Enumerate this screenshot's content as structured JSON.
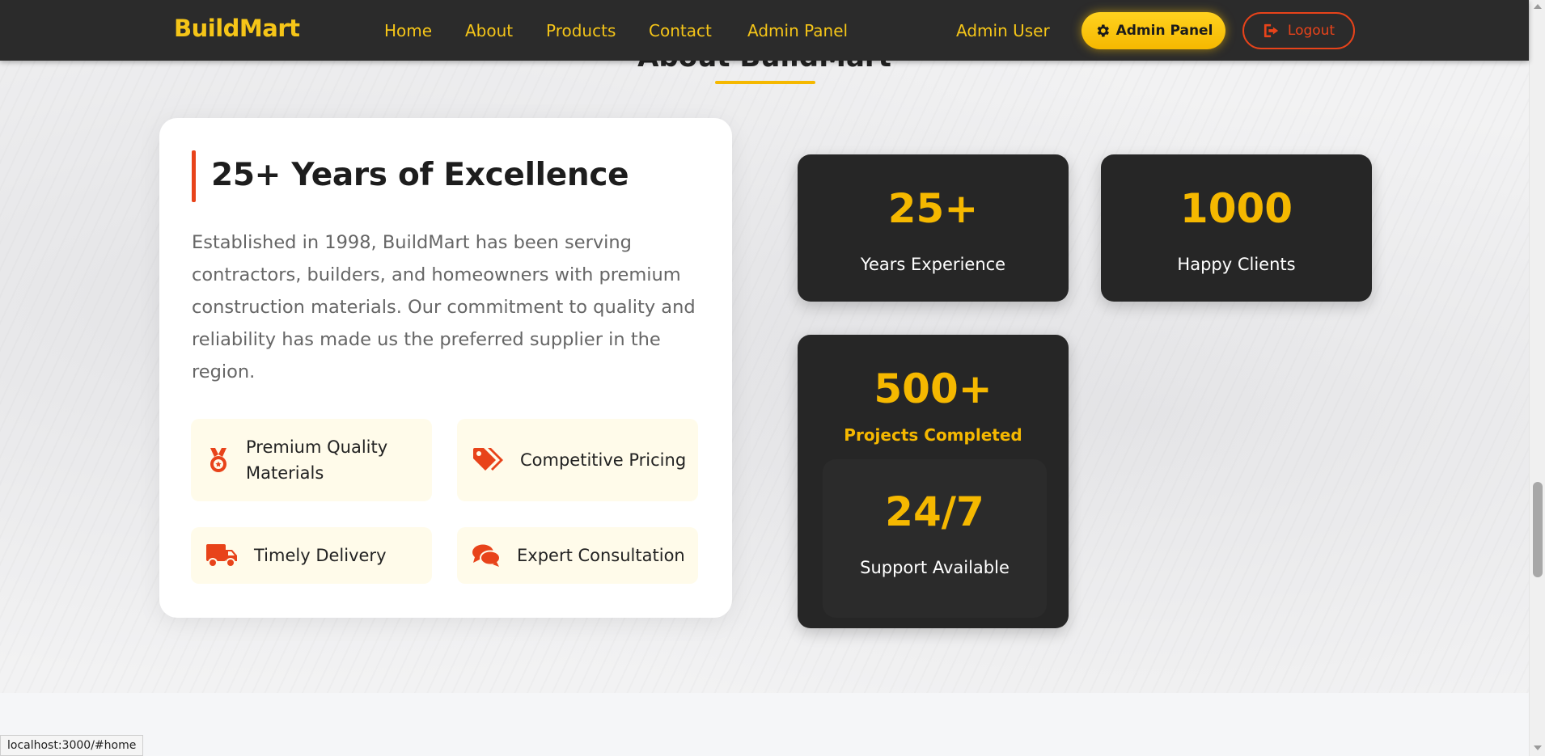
{
  "navbar": {
    "brand": "BuildMart",
    "links": [
      "Home",
      "About",
      "Products",
      "Contact",
      "Admin Panel"
    ],
    "user_name": "Admin User",
    "admin_button": "Admin Panel",
    "logout_button": "Logout"
  },
  "section": {
    "title": "About BuildMart"
  },
  "about_card": {
    "heading": "25+ Years of Excellence",
    "description": "Established in 1998, BuildMart has been serving contractors, builders, and homeowners with premium construction materials. Our commitment to quality and reliability has made us the preferred supplier in the region.",
    "features": [
      {
        "label": "Premium Quality Materials",
        "icon": "medal-icon"
      },
      {
        "label": "Competitive Pricing",
        "icon": "tags-icon"
      },
      {
        "label": "Timely Delivery",
        "icon": "truck-icon"
      },
      {
        "label": "Expert Consultation",
        "icon": "comments-icon"
      }
    ]
  },
  "stats": [
    {
      "value": "25+",
      "label": "Years Experience"
    },
    {
      "value": "1000",
      "label": "Happy Clients"
    },
    {
      "value": "500+",
      "label": "Projects Completed"
    },
    {
      "value": "24/7",
      "label": "Support Available"
    }
  ],
  "status_bar": {
    "url": "localhost:3000/#home"
  },
  "colors": {
    "accent_yellow": "#f5b800",
    "accent_orange": "#e8431a",
    "navbar_bg": "#2b2b2b",
    "stat_bg": "#262626"
  }
}
